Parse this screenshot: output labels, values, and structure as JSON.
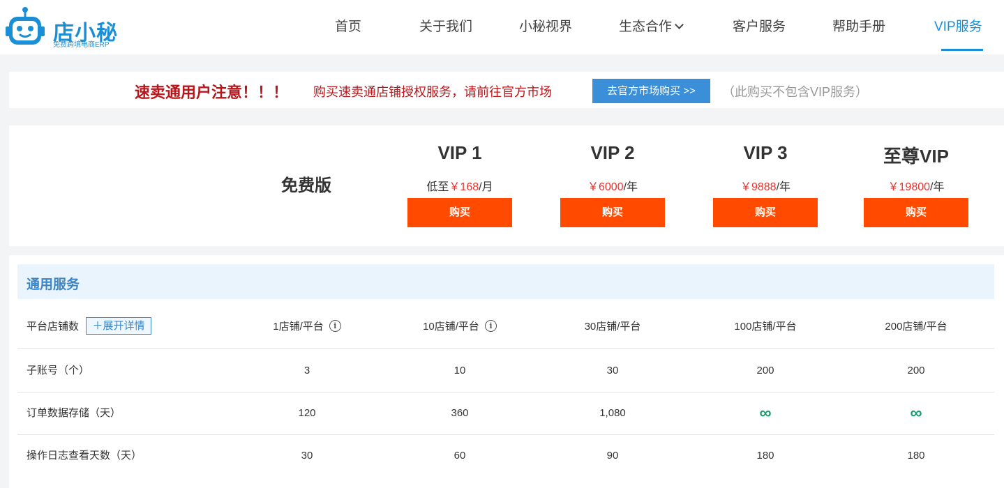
{
  "header": {
    "logo_text": "店小秘",
    "logo_sub": "免费跨境电商ERP",
    "nav": [
      {
        "label": "首页"
      },
      {
        "label": "关于我们"
      },
      {
        "label": "小秘视界"
      },
      {
        "label": "生态合作"
      },
      {
        "label": "客户服务"
      },
      {
        "label": "帮助手册"
      },
      {
        "label": "VIP服务"
      }
    ],
    "active_color": "#1a8fd6"
  },
  "notice": {
    "title": "速卖通用户注意！！！",
    "text": "购买速卖通店铺授权服务，请前往官方市场",
    "button": "去官方市场购买 >>",
    "note": "（此购买不包含VIP服务）"
  },
  "plans": {
    "free_label": "免费版",
    "buy_label": "购买",
    "items": [
      {
        "name": "VIP 1",
        "price_prefix": "低至",
        "price": "￥168",
        "period": "/月"
      },
      {
        "name": "VIP 2",
        "price_prefix": "",
        "price": "￥6000",
        "period": "/年"
      },
      {
        "name": "VIP 3",
        "price_prefix": "",
        "price": "￥9888",
        "period": "/年"
      },
      {
        "name": "至尊VIP",
        "price_prefix": "",
        "price": "￥19800",
        "period": "/年"
      }
    ]
  },
  "table": {
    "section_title": "通用服务",
    "expand_label": "＋展开详情",
    "infinity_symbol": "∞",
    "rows": [
      {
        "label": "平台店铺数",
        "values": [
          "1店铺/平台",
          "10店铺/平台",
          "30店铺/平台",
          "100店铺/平台",
          "200店铺/平台"
        ]
      },
      {
        "label": "子账号（个）",
        "values": [
          "3",
          "10",
          "30",
          "200",
          "200"
        ]
      },
      {
        "label": "订单数据存储（天）",
        "values": [
          "120",
          "360",
          "1,080",
          "∞",
          "∞"
        ]
      },
      {
        "label": "操作日志查看天数（天）",
        "values": [
          "30",
          "60",
          "90",
          "180",
          "180"
        ]
      }
    ],
    "infinity_color": "#1d9a6c"
  }
}
